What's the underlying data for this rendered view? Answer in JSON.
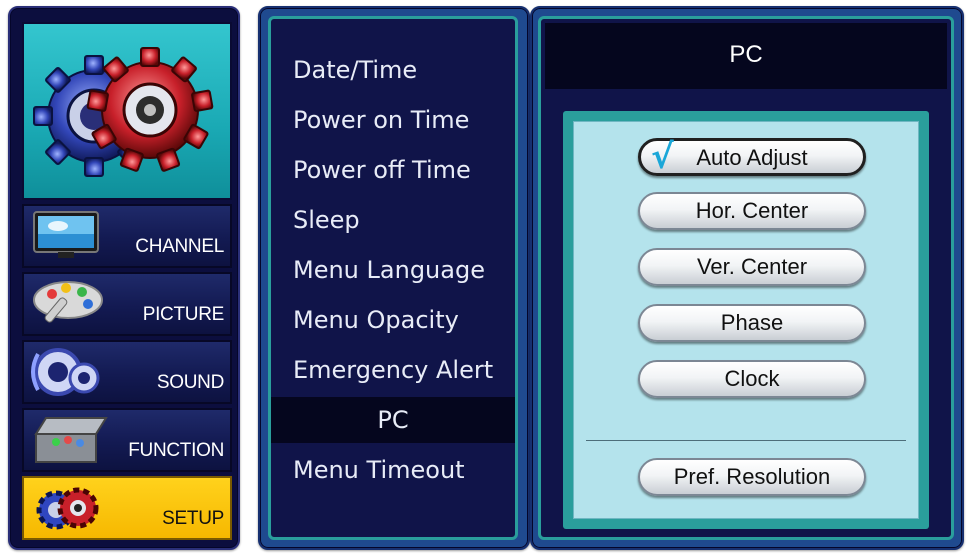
{
  "sidebar": {
    "items": [
      {
        "label": "CHANNEL",
        "icon": "tv-icon"
      },
      {
        "label": "PICTURE",
        "icon": "palette-icon"
      },
      {
        "label": "SOUND",
        "icon": "speaker-icon"
      },
      {
        "label": "FUNCTION",
        "icon": "toolbox-icon"
      },
      {
        "label": "SETUP",
        "icon": "gears-icon",
        "selected": true
      }
    ],
    "hero_icon": "gears-icon"
  },
  "menu": {
    "items": [
      {
        "label": "Date/Time"
      },
      {
        "label": "Power on Time"
      },
      {
        "label": "Power off Time"
      },
      {
        "label": "Sleep"
      },
      {
        "label": "Menu Language"
      },
      {
        "label": "Menu Opacity"
      },
      {
        "label": "Emergency Alert"
      },
      {
        "label": "PC",
        "selected": true
      },
      {
        "label": "Menu Timeout"
      }
    ]
  },
  "pc_panel": {
    "title": "PC",
    "buttons": [
      {
        "label": "Auto Adjust",
        "checked": true
      },
      {
        "label": "Hor. Center"
      },
      {
        "label": "Ver. Center"
      },
      {
        "label": "Phase"
      },
      {
        "label": "Clock"
      }
    ],
    "pref_button": "Pref. Resolution"
  },
  "colors": {
    "panel_bg": "#10124a",
    "accent_teal": "#2a9e9c",
    "selected_yellow": "#f6b800",
    "check_blue": "#1ba7d8"
  }
}
